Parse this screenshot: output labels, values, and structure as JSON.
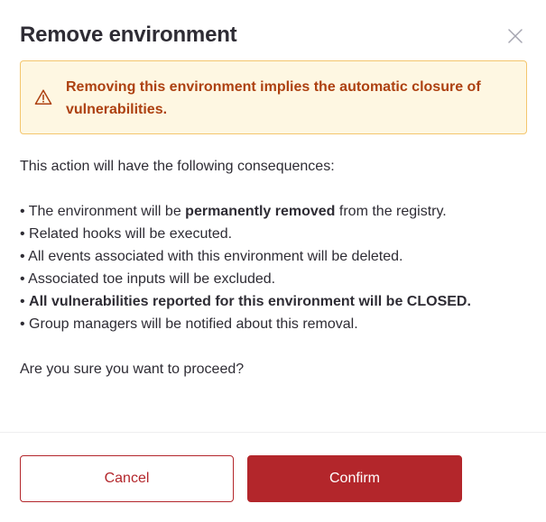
{
  "dialog": {
    "title": "Remove environment",
    "close_icon": "close-icon"
  },
  "alert": {
    "icon": "warning-triangle-icon",
    "message": "Removing this environment implies the automatic closure of vulnerabilities."
  },
  "body": {
    "intro": "This action will have the following consequences:",
    "consequences": [
      {
        "prefix": "• The environment will be ",
        "bold": "permanently removed",
        "suffix": " from the registry."
      },
      {
        "prefix": "• Related hooks will be executed.",
        "bold": "",
        "suffix": ""
      },
      {
        "prefix": "• All events associated with this environment will be deleted.",
        "bold": "",
        "suffix": ""
      },
      {
        "prefix": "• Associated toe inputs will be excluded.",
        "bold": "",
        "suffix": ""
      },
      {
        "prefix": "• ",
        "bold": "All vulnerabilities reported for this environment will be CLOSED.",
        "suffix": ""
      },
      {
        "prefix": "• Group managers will be notified about this removal.",
        "bold": "",
        "suffix": ""
      }
    ],
    "question": "Are you sure you want to proceed?"
  },
  "footer": {
    "cancel_label": "Cancel",
    "confirm_label": "Confirm"
  },
  "colors": {
    "primary": "#b3262b",
    "alert_bg": "#fef7e2",
    "alert_border": "#f4c66e",
    "alert_text": "#ad4111"
  }
}
